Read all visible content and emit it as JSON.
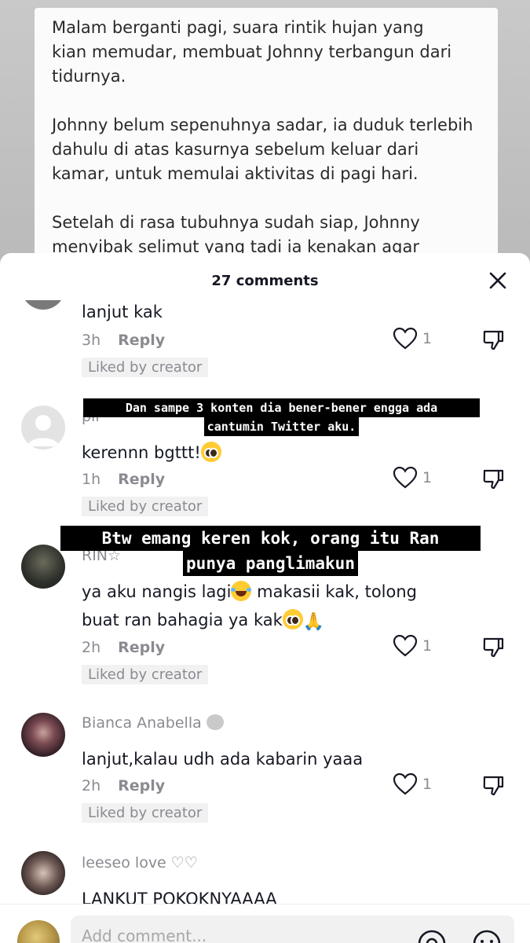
{
  "story": {
    "paragraphs": [
      "Malam berganti pagi, suara rintik hujan yang\nkian memudar, membuat Johnny terbangun dari\ntidurnya.",
      "Johnny belum sepenuhnya sadar, ia duduk terlebih\ndahulu di atas kasurnya sebelum keluar dari\nkamar, untuk memulai aktivitas di pagi hari.",
      "Setelah di rasa tubuhnya sudah siap, Johnny\nmenyibak selimut yang tadi ia kenakan agar"
    ]
  },
  "sheet": {
    "title": "27 comments"
  },
  "comments": [
    {
      "username": "",
      "text": "lanjut kak",
      "time": "3h",
      "reply": "Reply",
      "likes": "1",
      "badge": "Liked by creator"
    },
    {
      "username": "pli",
      "text": "kerennn bgttt!",
      "time": "1h",
      "reply": "Reply",
      "likes": "1",
      "badge": "Liked by creator"
    },
    {
      "username": "RIN☆",
      "text_line1": "ya aku nangis lagi",
      "text_line1b": " makasii kak, tolong",
      "text_line2": "buat ran bahagia ya kak",
      "time": "2h",
      "reply": "Reply",
      "likes": "1",
      "badge": "Liked by creator"
    },
    {
      "username": "Bianca Anabella",
      "text": "lanjut,kalau udh ada kabarin yaaa",
      "time": "2h",
      "reply": "Reply",
      "likes": "1",
      "badge": "Liked by creator"
    },
    {
      "username": "leeseo love ♡♡",
      "text": "LANKUT POKOKNYAAAA"
    }
  ],
  "captions": {
    "first": [
      "Dan sampe 3 konten dia bener-bener engga ada",
      "cantumin Twitter aku."
    ],
    "second": [
      "Btw emang keren kok, orang itu Ran",
      "punya panglimakun"
    ]
  },
  "input": {
    "placeholder": "Add comment..."
  },
  "icons": {
    "close": "close-icon",
    "like": "heart-icon",
    "dislike": "dislike-icon",
    "mention": "at-sign-icon",
    "emoji": "emoji-icon"
  }
}
